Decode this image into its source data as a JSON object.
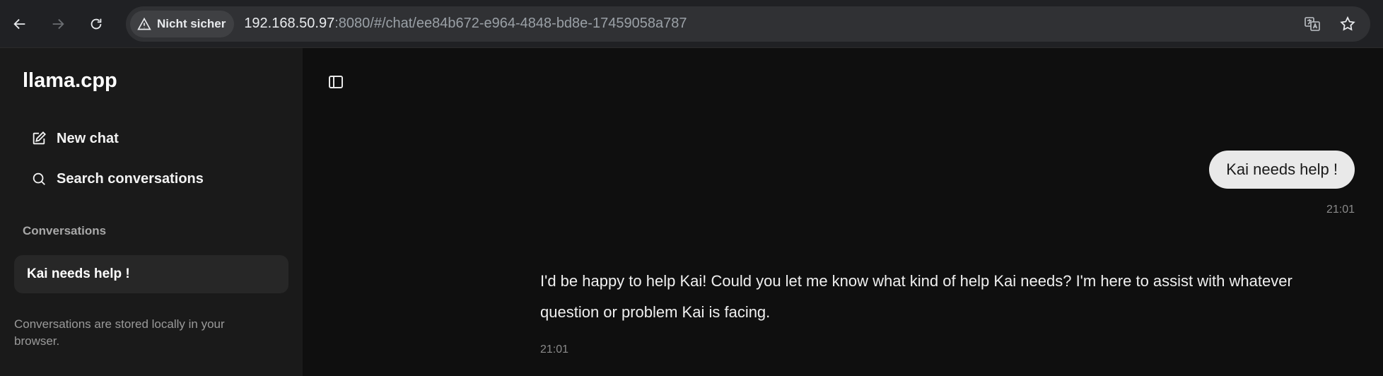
{
  "browser": {
    "security_label": "Nicht sicher",
    "url_host": "192.168.50.97",
    "url_rest": ":8080/#/chat/ee84b672-e964-4848-bd8e-17459058a787",
    "icons": [
      "back-icon",
      "forward-icon",
      "reload-icon",
      "warning-icon",
      "translate-icon",
      "star-icon"
    ]
  },
  "sidebar": {
    "brand": "llama.cpp",
    "new_chat_label": "New chat",
    "search_label": "Search conversations",
    "conversations_heading": "Conversations",
    "conversations": [
      {
        "title": "Kai needs help !"
      }
    ],
    "footnote": "Conversations are stored locally in your browser."
  },
  "chat": {
    "messages": [
      {
        "role": "user",
        "text": "Kai needs help !",
        "time": "21:01"
      },
      {
        "role": "assistant",
        "text": "I'd be happy to help Kai! Could you let me know what kind of help Kai needs? I'm here to assist with whatever question or problem Kai is facing.",
        "time": "21:01"
      }
    ]
  },
  "colors": {
    "chrome_bg": "#202124",
    "sidebar_bg": "#1a1a1a",
    "main_bg": "#0f0f0f",
    "user_bubble_bg": "#e9e9e9"
  }
}
